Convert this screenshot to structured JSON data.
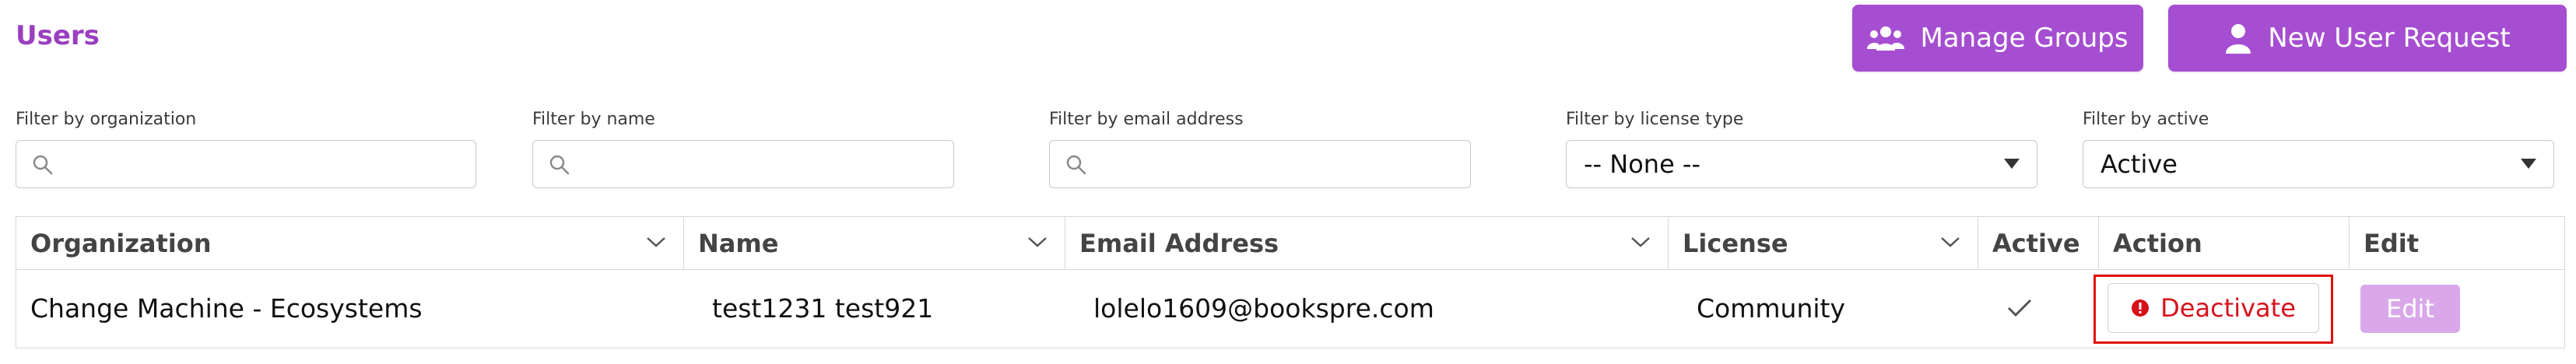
{
  "header": {
    "title": "Users",
    "manage_groups_label": "Manage Groups",
    "new_user_request_label": "New User Request"
  },
  "filters": {
    "organization": {
      "label": "Filter by organization",
      "value": ""
    },
    "name": {
      "label": "Filter by name",
      "value": ""
    },
    "email": {
      "label": "Filter by email address",
      "value": ""
    },
    "license_type": {
      "label": "Filter by license type",
      "value": "-- None --"
    },
    "active": {
      "label": "Filter by active",
      "value": "Active"
    }
  },
  "table": {
    "columns": {
      "organization": "Organization",
      "name": "Name",
      "email": "Email Address",
      "license": "License",
      "active": "Active",
      "action": "Action",
      "edit": "Edit"
    },
    "rows": [
      {
        "organization": "Change Machine - Ecosystems",
        "name": "test1231 test921",
        "email": "lolelo1609@bookspre.com",
        "license": "Community",
        "active_icon": "check-icon",
        "action_label": "Deactivate",
        "edit_label": "Edit"
      }
    ]
  },
  "colors": {
    "brand_purple": "#a64ed1",
    "title_purple": "#9a3fbf",
    "danger_red": "#d6111c",
    "edit_disabled": "#d9a7ea"
  }
}
